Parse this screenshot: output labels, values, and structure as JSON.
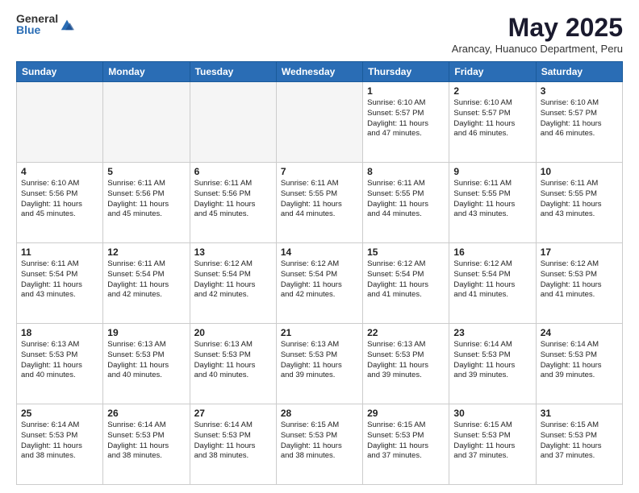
{
  "logo": {
    "general": "General",
    "blue": "Blue"
  },
  "title": "May 2025",
  "subtitle": "Arancay, Huanuco Department, Peru",
  "days_of_week": [
    "Sunday",
    "Monday",
    "Tuesday",
    "Wednesday",
    "Thursday",
    "Friday",
    "Saturday"
  ],
  "weeks": [
    [
      {
        "day": "",
        "info": ""
      },
      {
        "day": "",
        "info": ""
      },
      {
        "day": "",
        "info": ""
      },
      {
        "day": "",
        "info": ""
      },
      {
        "day": "1",
        "info": "Sunrise: 6:10 AM\nSunset: 5:57 PM\nDaylight: 11 hours\nand 47 minutes."
      },
      {
        "day": "2",
        "info": "Sunrise: 6:10 AM\nSunset: 5:57 PM\nDaylight: 11 hours\nand 46 minutes."
      },
      {
        "day": "3",
        "info": "Sunrise: 6:10 AM\nSunset: 5:57 PM\nDaylight: 11 hours\nand 46 minutes."
      }
    ],
    [
      {
        "day": "4",
        "info": "Sunrise: 6:10 AM\nSunset: 5:56 PM\nDaylight: 11 hours\nand 45 minutes."
      },
      {
        "day": "5",
        "info": "Sunrise: 6:11 AM\nSunset: 5:56 PM\nDaylight: 11 hours\nand 45 minutes."
      },
      {
        "day": "6",
        "info": "Sunrise: 6:11 AM\nSunset: 5:56 PM\nDaylight: 11 hours\nand 45 minutes."
      },
      {
        "day": "7",
        "info": "Sunrise: 6:11 AM\nSunset: 5:55 PM\nDaylight: 11 hours\nand 44 minutes."
      },
      {
        "day": "8",
        "info": "Sunrise: 6:11 AM\nSunset: 5:55 PM\nDaylight: 11 hours\nand 44 minutes."
      },
      {
        "day": "9",
        "info": "Sunrise: 6:11 AM\nSunset: 5:55 PM\nDaylight: 11 hours\nand 43 minutes."
      },
      {
        "day": "10",
        "info": "Sunrise: 6:11 AM\nSunset: 5:55 PM\nDaylight: 11 hours\nand 43 minutes."
      }
    ],
    [
      {
        "day": "11",
        "info": "Sunrise: 6:11 AM\nSunset: 5:54 PM\nDaylight: 11 hours\nand 43 minutes."
      },
      {
        "day": "12",
        "info": "Sunrise: 6:11 AM\nSunset: 5:54 PM\nDaylight: 11 hours\nand 42 minutes."
      },
      {
        "day": "13",
        "info": "Sunrise: 6:12 AM\nSunset: 5:54 PM\nDaylight: 11 hours\nand 42 minutes."
      },
      {
        "day": "14",
        "info": "Sunrise: 6:12 AM\nSunset: 5:54 PM\nDaylight: 11 hours\nand 42 minutes."
      },
      {
        "day": "15",
        "info": "Sunrise: 6:12 AM\nSunset: 5:54 PM\nDaylight: 11 hours\nand 41 minutes."
      },
      {
        "day": "16",
        "info": "Sunrise: 6:12 AM\nSunset: 5:54 PM\nDaylight: 11 hours\nand 41 minutes."
      },
      {
        "day": "17",
        "info": "Sunrise: 6:12 AM\nSunset: 5:53 PM\nDaylight: 11 hours\nand 41 minutes."
      }
    ],
    [
      {
        "day": "18",
        "info": "Sunrise: 6:13 AM\nSunset: 5:53 PM\nDaylight: 11 hours\nand 40 minutes."
      },
      {
        "day": "19",
        "info": "Sunrise: 6:13 AM\nSunset: 5:53 PM\nDaylight: 11 hours\nand 40 minutes."
      },
      {
        "day": "20",
        "info": "Sunrise: 6:13 AM\nSunset: 5:53 PM\nDaylight: 11 hours\nand 40 minutes."
      },
      {
        "day": "21",
        "info": "Sunrise: 6:13 AM\nSunset: 5:53 PM\nDaylight: 11 hours\nand 39 minutes."
      },
      {
        "day": "22",
        "info": "Sunrise: 6:13 AM\nSunset: 5:53 PM\nDaylight: 11 hours\nand 39 minutes."
      },
      {
        "day": "23",
        "info": "Sunrise: 6:14 AM\nSunset: 5:53 PM\nDaylight: 11 hours\nand 39 minutes."
      },
      {
        "day": "24",
        "info": "Sunrise: 6:14 AM\nSunset: 5:53 PM\nDaylight: 11 hours\nand 39 minutes."
      }
    ],
    [
      {
        "day": "25",
        "info": "Sunrise: 6:14 AM\nSunset: 5:53 PM\nDaylight: 11 hours\nand 38 minutes."
      },
      {
        "day": "26",
        "info": "Sunrise: 6:14 AM\nSunset: 5:53 PM\nDaylight: 11 hours\nand 38 minutes."
      },
      {
        "day": "27",
        "info": "Sunrise: 6:14 AM\nSunset: 5:53 PM\nDaylight: 11 hours\nand 38 minutes."
      },
      {
        "day": "28",
        "info": "Sunrise: 6:15 AM\nSunset: 5:53 PM\nDaylight: 11 hours\nand 38 minutes."
      },
      {
        "day": "29",
        "info": "Sunrise: 6:15 AM\nSunset: 5:53 PM\nDaylight: 11 hours\nand 37 minutes."
      },
      {
        "day": "30",
        "info": "Sunrise: 6:15 AM\nSunset: 5:53 PM\nDaylight: 11 hours\nand 37 minutes."
      },
      {
        "day": "31",
        "info": "Sunrise: 6:15 AM\nSunset: 5:53 PM\nDaylight: 11 hours\nand 37 minutes."
      }
    ]
  ]
}
